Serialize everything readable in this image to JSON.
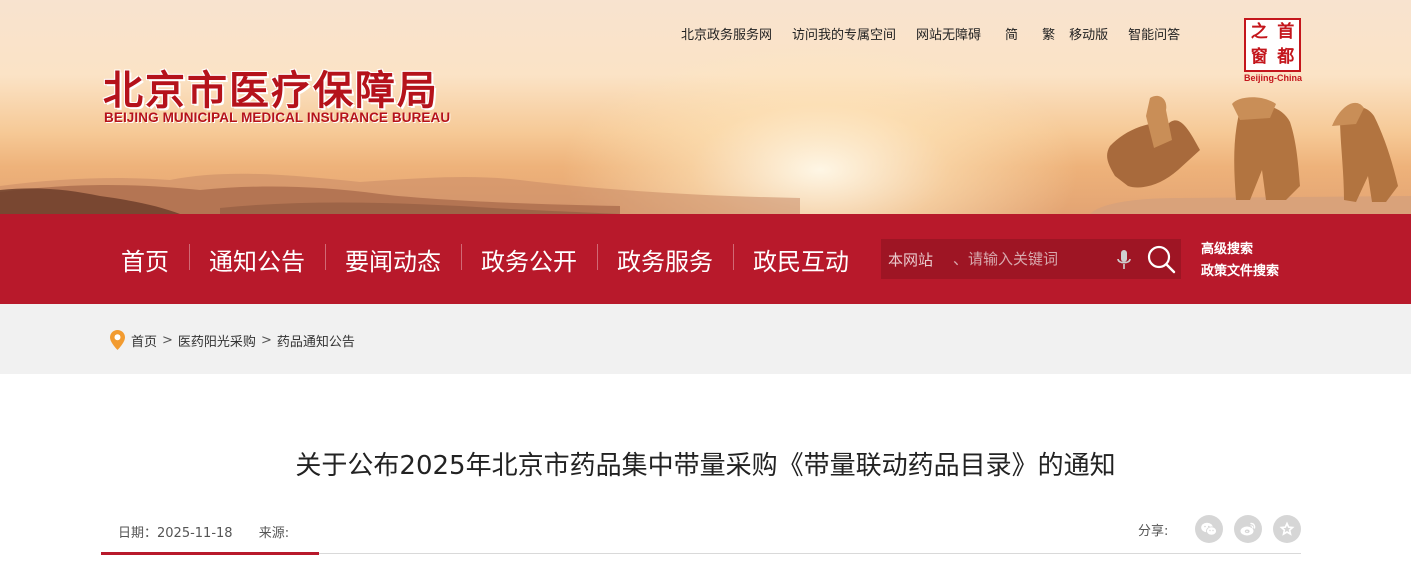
{
  "header": {
    "utility_links": [
      "北京政务服务网",
      "访问我的专属空间",
      "网站无障碍",
      "简",
      "繁",
      "移动版",
      "智能问答"
    ],
    "logo_zh": "北京市医疗保障局",
    "logo_en": "BEIJING MUNICIPAL MEDICAL INSURANCE BUREAU",
    "seal": {
      "chars": [
        "之",
        "首",
        "窗",
        "都"
      ],
      "label": "Beijing-China"
    }
  },
  "nav": {
    "items": [
      "首页",
      "通知公告",
      "要闻动态",
      "政务公开",
      "政务服务",
      "政民互动"
    ],
    "search": {
      "scope": "本网站",
      "placeholder": "、请输入关键词"
    },
    "advanced_search": "高级搜索",
    "policy_search": "政策文件搜索"
  },
  "breadcrumb": [
    "首页",
    "医药阳光采购",
    "药品通知公告"
  ],
  "article": {
    "title": "关于公布2025年北京市药品集中带量采购《带量联动药品目录》的通知",
    "date_label": "日期：",
    "date": "2025-11-18",
    "source_label": "来源:",
    "share_label": "分享:",
    "share_icons": [
      "wechat-icon",
      "weibo-icon",
      "favorite-icon"
    ]
  },
  "colors": {
    "brand_red": "#b8192b",
    "search_bg": "#9e1524",
    "crumb_bg": "#f1f1f1"
  }
}
